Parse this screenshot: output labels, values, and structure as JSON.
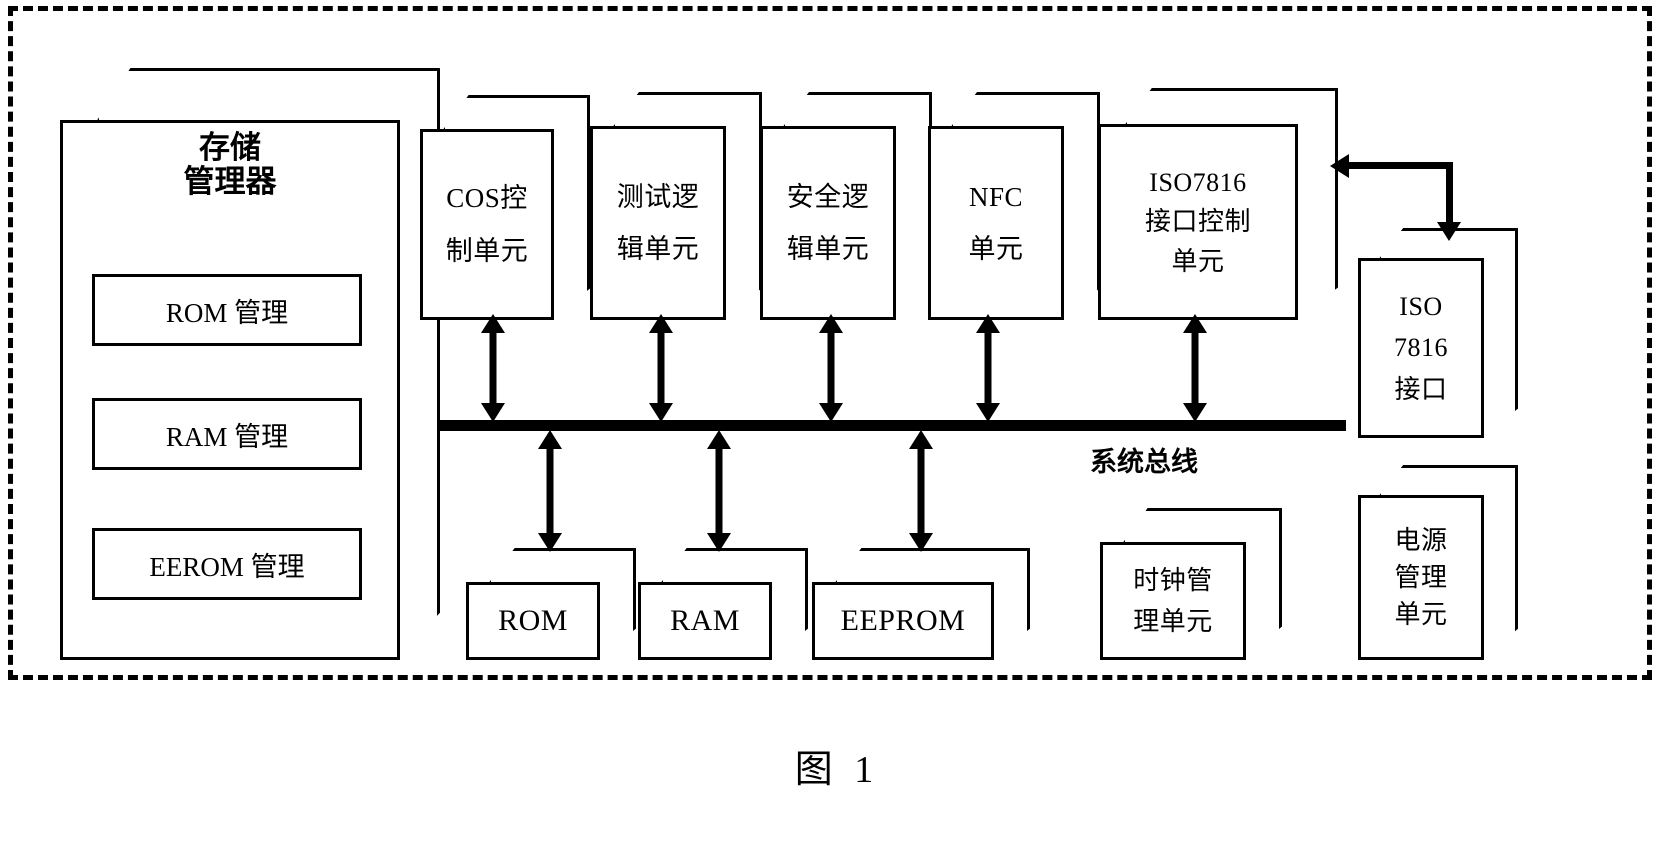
{
  "figure": {
    "caption": "图 1"
  },
  "memory_manager": {
    "title_line1": "存储",
    "title_line2": "管理器",
    "submodules": [
      {
        "label": "ROM 管理"
      },
      {
        "label": "RAM 管理"
      },
      {
        "label": "EEROM 管理"
      }
    ]
  },
  "bus": {
    "label": "系统总线"
  },
  "top_units": [
    {
      "lines": [
        "COS控",
        "制单元"
      ]
    },
    {
      "lines": [
        "测试逻",
        "辑单元"
      ]
    },
    {
      "lines": [
        "安全逻",
        "辑单元"
      ]
    },
    {
      "lines": [
        "NFC",
        "单元"
      ]
    },
    {
      "lines": [
        "ISO7816",
        "接口控制",
        "单元"
      ]
    }
  ],
  "memory_blocks": [
    {
      "label": "ROM"
    },
    {
      "label": "RAM"
    },
    {
      "label": "EEPROM"
    }
  ],
  "clock_unit": {
    "lines": [
      "时钟管",
      "理单元"
    ]
  },
  "right_units": [
    {
      "lines": [
        "ISO",
        "7816",
        "接口"
      ]
    },
    {
      "lines": [
        "电源",
        "管理",
        "单元"
      ]
    }
  ],
  "colors": {
    "stroke": "#000000",
    "background": "#ffffff"
  }
}
